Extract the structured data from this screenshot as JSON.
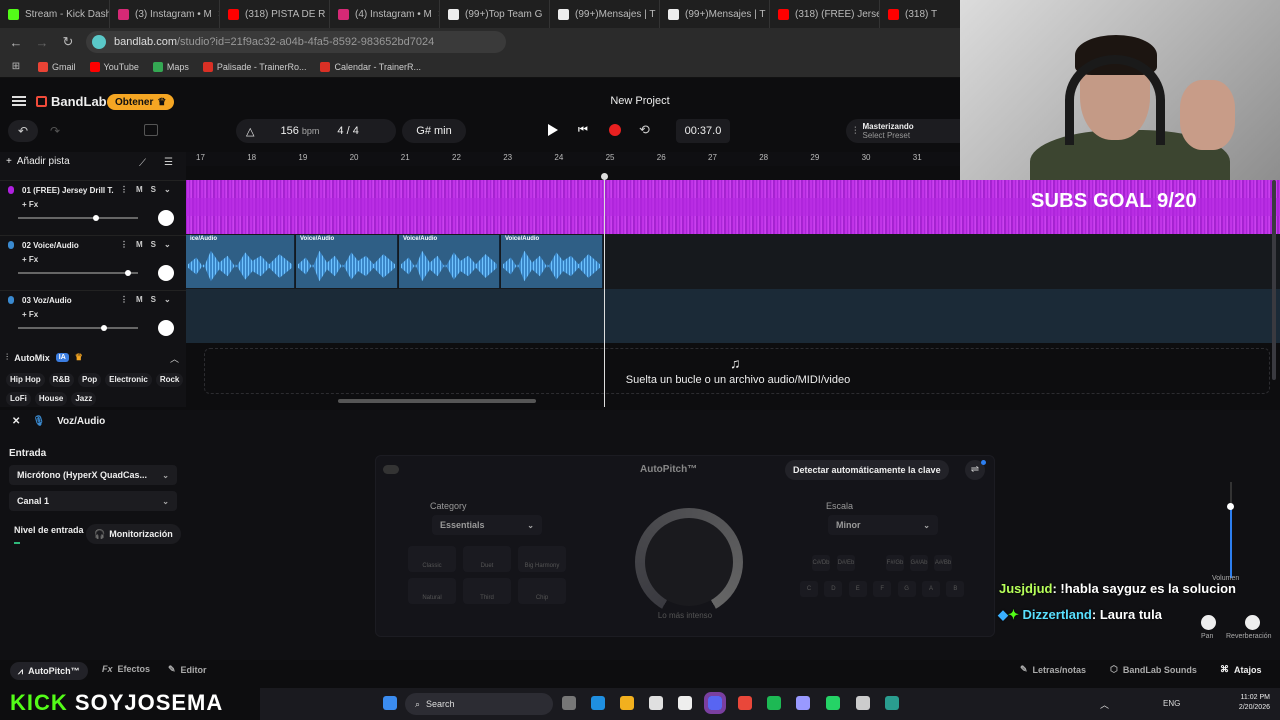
{
  "browser": {
    "tabs": [
      {
        "label": "Stream - Kick Dash",
        "color": "#53fc18"
      },
      {
        "label": "(3) Instagram • M",
        "color": "#d62976"
      },
      {
        "label": "(318) PISTA DE R",
        "color": "#ff0000"
      },
      {
        "label": "(4) Instagram • M",
        "color": "#d62976"
      },
      {
        "label": "(99+)Top Team G",
        "color": "#eeeeee"
      },
      {
        "label": "(99+)Mensajes | T",
        "color": "#eeeeee"
      },
      {
        "label": "(99+)Mensajes | T",
        "color": "#eeeeee"
      },
      {
        "label": "(318) (FREE) Jerse",
        "color": "#ff0000"
      },
      {
        "label": "(318) T",
        "color": "#ff0000"
      }
    ],
    "url_host": "bandlab.com",
    "url_path": "/studio?id=21f9ac32-a04b-4fa5-8592-983652bd7024",
    "bookmarks": [
      {
        "label": "Gmail",
        "color": "#ea4335"
      },
      {
        "label": "YouTube",
        "color": "#ff0000"
      },
      {
        "label": "Maps",
        "color": "#34a853"
      },
      {
        "label": "Palisade - TrainerRo...",
        "color": "#d93025"
      },
      {
        "label": "Calendar - TrainerR...",
        "color": "#d93025"
      }
    ]
  },
  "app": {
    "brand": "BandLab",
    "obtener": "Obtener",
    "project_title": "New Project",
    "tempo": "156",
    "bpm": "bpm",
    "sig_num": "4",
    "sig_sep": "/",
    "sig_den": "4",
    "key": "G# min",
    "time": "00:37.0",
    "master_title": "Masterizando",
    "master_sub": "Select Preset",
    "add_track": "Añadir pista"
  },
  "ruler": [
    "17",
    "18",
    "19",
    "20",
    "21",
    "22",
    "23",
    "24",
    "25",
    "26",
    "27",
    "28",
    "29",
    "30",
    "31"
  ],
  "tracks": [
    {
      "name": "01 (FREE) Jersey Drill T...",
      "fx": "+ Fx",
      "m": "M",
      "s": "S",
      "color": "#b020e0",
      "volume": 0.65
    },
    {
      "name": "02 Voice/Audio",
      "fx": "+ Fx",
      "m": "M",
      "s": "S",
      "color": "#3a8ad0",
      "volume": 0.92
    },
    {
      "name": "03 Voz/Audio",
      "fx": "+ Fx",
      "m": "M",
      "s": "S",
      "color": "#3a8ad0",
      "volume": 0.72
    }
  ],
  "clips": [
    "ice/Audio",
    "Voice/Audio",
    "Voice/Audio",
    "Voice/Audio"
  ],
  "drop_text": "Suelta un bucle o un archivo audio/MIDI/video",
  "overlay": {
    "subs_goal": "SUBS GOAL 9/20"
  },
  "automix": {
    "label": "AutoMix",
    "badge": "IA",
    "genres_row1": [
      "Hip Hop",
      "R&B",
      "Pop",
      "Electronic",
      "Rock"
    ],
    "genres_row2": [
      "LoFi",
      "House",
      "Jazz"
    ]
  },
  "inspector": {
    "track_name": "Voz/Audio",
    "entrada": "Entrada",
    "mic": "Micrófono (HyperX QuadCas...",
    "canal": "Canal 1",
    "nivel": "Nivel de entrada",
    "monitor": "Monitorización",
    "input_level": 0.04
  },
  "autopitch": {
    "title": "AutoPitch™",
    "detect": "Detectar automáticamente la clave",
    "category_label": "Category",
    "category_value": "Essentials",
    "escala_label": "Escala",
    "escala_value": "Minor",
    "styles": [
      "Classic",
      "Duet",
      "Big Harmony",
      "Natural",
      "Third",
      "Chip"
    ],
    "dial_label": "Lo más intenso",
    "keys_sharp": [
      "C#/Db",
      "D#/Eb",
      "F#/Gb",
      "G#/Ab",
      "A#/Bb"
    ],
    "keys_natural": [
      "C",
      "D",
      "E",
      "F",
      "G",
      "A",
      "B"
    ]
  },
  "mixer": {
    "volume": "Volumen",
    "pan": "Pan",
    "reverb": "Reverberación",
    "volume_level": 0.74
  },
  "chat": [
    {
      "user": "Jusjdjud",
      "msg": ": !habla sayguz es la solucion"
    },
    {
      "user": "Dizzertland",
      "msg": ": Laura tula"
    }
  ],
  "bottom_tabs": {
    "autopitch": "AutoPitch™",
    "effects": "Efectos",
    "editor": "Editor",
    "lyrics": "Letras/notas",
    "sounds": "BandLab Sounds",
    "shortcuts": "Atajos"
  },
  "stream": {
    "kick": "KICK",
    "name": "SOYJOSEMA"
  },
  "taskbar": {
    "search": "Search",
    "lang": "ENG",
    "time": "11:02 PM",
    "date": "2/20/2026"
  }
}
